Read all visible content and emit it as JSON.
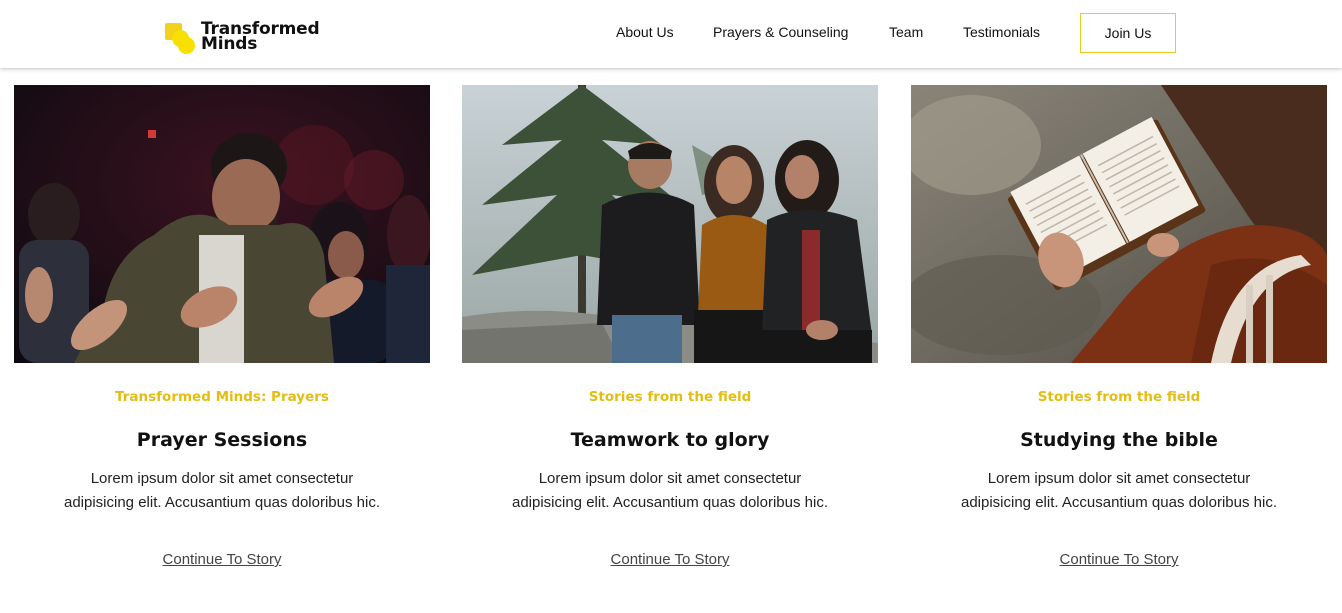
{
  "brand": {
    "line1": "Transformed",
    "line2": "Minds"
  },
  "nav": {
    "items": [
      {
        "label": "About Us"
      },
      {
        "label": "Prayers & Counseling"
      },
      {
        "label": "Team"
      },
      {
        "label": "Testimonials"
      }
    ],
    "cta_label": "Join Us"
  },
  "colors": {
    "accent": "#e3bd12",
    "logo_yellow": "#f7e000",
    "button_border": "#e8cc1e"
  },
  "cards": [
    {
      "eyebrow": "Transformed Minds: Prayers",
      "title": "Prayer Sessions",
      "body": "Lorem ipsum dolor sit amet consectetur adipisicing elit. Accusantium quas doloribus hic.",
      "link": "Continue To Story",
      "image": "worship-prayer-photo"
    },
    {
      "eyebrow": "Stories from the field",
      "title": "Teamwork to glory",
      "body": "Lorem ipsum dolor sit amet consectetur adipisicing elit. Accusantium quas doloribus hic.",
      "link": "Continue To Story",
      "image": "friends-laughing-photo"
    },
    {
      "eyebrow": "Stories from the field",
      "title": "Studying the bible",
      "body": "Lorem ipsum dolor sit amet consectetur adipisicing elit. Accusantium quas doloribus hic.",
      "link": "Continue To Story",
      "image": "reading-bible-photo"
    }
  ]
}
